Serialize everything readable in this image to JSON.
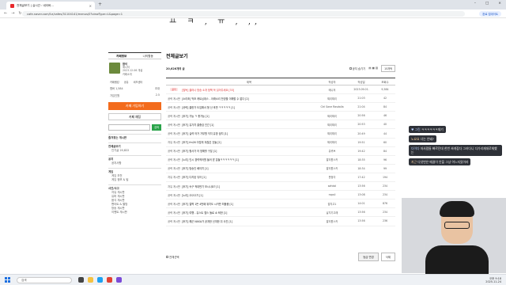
{
  "browser": {
    "tab_title": "전체글보기 | 실시간 : 네이버...",
    "tab_close": "×",
    "new_tab": "+",
    "url": "cafe.naver.com/f-e/cafes/31104141/menus/0?viewType=L&page=1",
    "update_btn": "완료 업데이트",
    "win_min": "–",
    "win_max": "□",
    "win_close": "×"
  },
  "banner_text": "ㅛ  ㅋ  ,   ㅠ ,  ,, ",
  "sidebar": {
    "tabs": [
      "카페정보",
      "나의활동"
    ],
    "profile": {
      "name": "참석",
      "grade": "매니저",
      "date": "2023.12.06 개설",
      "link": "카페소개"
    },
    "links": [
      "카페랭킹",
      "공유",
      "비즈센터"
    ],
    "stats": [
      {
        "label": "멤버 1,584",
        "value": "초대"
      },
      {
        "label": "가입인원",
        "value": "2.5"
      }
    ],
    "join_btn": "카페 가입하기",
    "chat_btn": "카페 채팅",
    "search_btn": "검색",
    "sections": [
      {
        "header": "즐겨찾는 게시판",
        "items": []
      },
      {
        "header": "전체글보기",
        "items": [
          {
            "label": "인기글",
            "count": "20,822"
          }
        ]
      },
      {
        "header": "공지",
        "items": [
          {
            "label": "공지사항",
            "count": ""
          }
        ]
      },
      {
        "header": "게임",
        "items": [
          {
            "label": "게임 추천",
            "count": ""
          },
          {
            "label": "게임 정보 & 팁",
            "count": ""
          }
        ]
      },
      {
        "header": "사건/사고",
        "items": [
          {
            "label": "자유 게시판",
            "count": ""
          },
          {
            "label": "유머 게시판",
            "count": ""
          },
          {
            "label": "음식 게시판",
            "count": ""
          },
          {
            "label": "팬아트 & 짤방",
            "count": ""
          },
          {
            "label": "방송 게시판",
            "count": ""
          },
          {
            "label": "이벤트 게시판",
            "count": ""
          }
        ]
      }
    ]
  },
  "content": {
    "title": "전체글보기",
    "count": "20,626개의 글",
    "notice_toggle": "공지 숨기기",
    "view_select": "15개씩",
    "columns": [
      "제목",
      "작성자",
      "작성일",
      "조회수"
    ],
    "rows": [
      {
        "tag": "공지",
        "title": "[필독] 클라나 방송 소개 정책 꼭 읽어주세요 [33]",
        "author": "매니저",
        "date": "2023.09.01.",
        "views": "9,584",
        "notice": true
      },
      {
        "tag": "공략 게시판",
        "title": "[소리조] 먹조 캐트닝데스 - 아래소리 찬양을 이해할 수 없다 [2]",
        "author": "찌리찌리",
        "date": "21:03",
        "views": "42"
      },
      {
        "tag": "공략 게시판",
        "title": "[공략] 클한가 도입해서 형 산 후반 ㅋㅋㅋㅋㅋ [1]",
        "author": "Ctrl Sane Rasdalla",
        "date": "21:04",
        "views": "84"
      },
      {
        "tag": "공략 게시판",
        "title": "[후기] 가능 ㅋ 좋가능 [1]",
        "author": "찌리찌리",
        "date": "20:56",
        "views": "46"
      },
      {
        "tag": "공략 게시판",
        "title": "[후기] 유가치 클충검 인간 [1]",
        "author": "찌리찌리",
        "date": "20:53",
        "views": "40"
      },
      {
        "tag": "공략 게시판",
        "title": "[후기] 실력 어거 가부원 익지 유망 꿈치 [1]",
        "author": "찌리찌리",
        "date": "20:49",
        "views": "44"
      },
      {
        "tag": "자유 게시판",
        "title": "[후기] fm26 이럴게 겨찮은 것들 [2]",
        "author": "찌리찌리",
        "date": "19:51",
        "views": "60"
      },
      {
        "tag": "공략 게시판",
        "title": "[후기] 형사가 어 방해를 구분 [1]",
        "author": "유퀴브",
        "date": "19:42",
        "views": "84"
      },
      {
        "tag": "공략 게시판",
        "title": "[노리] 인시 경력적어원 들어 받 분들ㅋㅋㅋㅋㅋㅋ [1]",
        "author": "알티원스카",
        "date": "18:35",
        "views": "96"
      },
      {
        "tag": "공략 게시판",
        "title": "[후기] 방송인 베이치 [1]",
        "author": "알티원스카",
        "date": "18:34",
        "views": "99"
      },
      {
        "tag": "자유 게시판",
        "title": "[후기] 다지된 뒤어 [1]",
        "author": "운정이",
        "date": "17:42",
        "views": "194"
      },
      {
        "tag": "자유 게시판",
        "title": "[후기] 속구 적대번기 보시나요? [1]",
        "author": "sahdol",
        "date": "13:56",
        "views": "234"
      },
      {
        "tag": "공략 게시판",
        "title": "[노리] 으으으가 [1]",
        "author": "rapsil",
        "date": "13:08",
        "views": "234"
      },
      {
        "tag": "공략 게시판",
        "title": "[후기] 절벽 1뜬 4번째 위치도 시카만 떠볼중 [1]",
        "author": "잡지고1",
        "date": "14:01",
        "views": "876"
      },
      {
        "tag": "공략 게시판",
        "title": "[후기] 여행 - 유스트 앱스 둘로 쇼 퇴한 [1]",
        "author": "날치기고래",
        "date": "13:56",
        "views": "234"
      },
      {
        "tag": "공략 게시판",
        "title": "[후기] 해군 NASA가 공개한 신개한 뒤 사진 [1]",
        "author": "알티원스카",
        "date": "13:56",
        "views": "236"
      }
    ],
    "select_all": "전체선택",
    "grade_btn": "등급 변경",
    "delete_btn": "삭제"
  },
  "chat": [
    {
      "user": "♥ 그린",
      "text": "ㅋㅋㅋㅋㅋㅋ재기"
    },
    {
      "user": "노요요",
      "text": "너는 안돼?"
    },
    {
      "user": "다이다",
      "text": "저사람들 빠르던데 한번 싸게잡다 그러다니 다가리재데로체했는"
    },
    {
      "user": "지근",
      "text": "다섯번은 매끌이 안을 그냥 어느지었이라"
    }
  ],
  "taskbar": {
    "search": "검색",
    "time": "오후 9:18",
    "date": "2025-11-24"
  },
  "colors": {
    "accent": "#f36b1c",
    "search_green": "#2aa34a",
    "notice_red": "#d33333"
  }
}
